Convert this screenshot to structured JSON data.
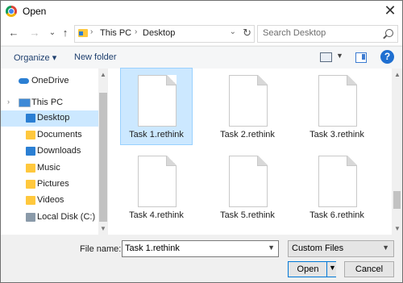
{
  "window": {
    "title": "Open",
    "close_glyph": "✕"
  },
  "navigation": {
    "back_glyph": "←",
    "forward_glyph": "→",
    "recent_glyph": "⌄",
    "up_glyph": "↑",
    "breadcrumb": [
      "This PC",
      "Desktop"
    ],
    "separator": "›",
    "dropdown_glyph": "⌄",
    "refresh_glyph": "↻",
    "search_placeholder": "Search Desktop"
  },
  "command_bar": {
    "organize_label": "Organize ▾",
    "new_folder_label": "New folder",
    "views_drop_glyph": "▼",
    "help_glyph": "?"
  },
  "sidebar": {
    "items": [
      {
        "label": "OneDrive",
        "icon": "cloud-icon",
        "color": "#2b7fd3"
      },
      {
        "label": "This PC",
        "icon": "computer-icon",
        "color": "#3d89d6"
      },
      {
        "label": "Desktop",
        "icon": "desktop-folder-icon",
        "color": "#2b7fd3",
        "selected": true
      },
      {
        "label": "Documents",
        "icon": "documents-folder-icon",
        "color": "#ffc83d"
      },
      {
        "label": "Downloads",
        "icon": "downloads-folder-icon",
        "color": "#2b7fd3"
      },
      {
        "label": "Music",
        "icon": "music-folder-icon",
        "color": "#ffc83d"
      },
      {
        "label": "Pictures",
        "icon": "pictures-folder-icon",
        "color": "#ffc83d"
      },
      {
        "label": "Videos",
        "icon": "videos-folder-icon",
        "color": "#ffc83d"
      },
      {
        "label": "Local Disk (C:)",
        "icon": "disk-icon",
        "color": "#8a9aa9"
      }
    ],
    "chevron_glyph": "›"
  },
  "files": [
    {
      "name": "Task 1.rethink",
      "selected": true
    },
    {
      "name": "Task 2.rethink"
    },
    {
      "name": "Task 3.rethink"
    },
    {
      "name": "Task 4.rethink"
    },
    {
      "name": "Task 5.rethink"
    },
    {
      "name": "Task 6.rethink"
    }
  ],
  "footer": {
    "file_name_label": "File name:",
    "file_name_value": "Task 1.rethink",
    "filter_value": "Custom Files",
    "open_label": "Open",
    "cancel_label": "Cancel",
    "drop_glyph": "▼"
  },
  "scroll_arrows": {
    "up": "▲",
    "down": "▼"
  },
  "colors": {
    "selection": "#cce8ff",
    "accent": "#0078d7",
    "link": "#1e3f6e"
  }
}
